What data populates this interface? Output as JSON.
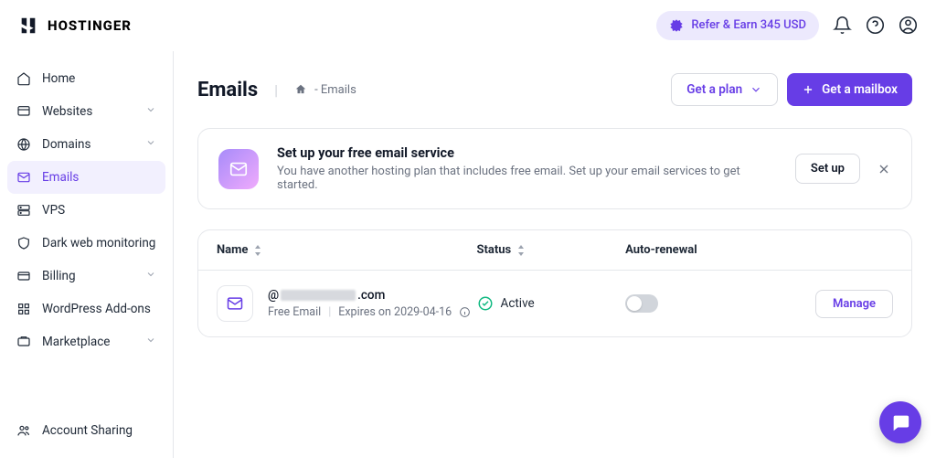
{
  "brand": "HOSTINGER",
  "header": {
    "refer_label": "Refer & Earn 345 USD"
  },
  "sidebar": {
    "items": [
      {
        "label": "Home",
        "icon": "home",
        "active": false,
        "expandable": false
      },
      {
        "label": "Websites",
        "icon": "websites",
        "active": false,
        "expandable": true
      },
      {
        "label": "Domains",
        "icon": "domains",
        "active": false,
        "expandable": true
      },
      {
        "label": "Emails",
        "icon": "emails",
        "active": true,
        "expandable": false
      },
      {
        "label": "VPS",
        "icon": "vps",
        "active": false,
        "expandable": false
      },
      {
        "label": "Dark web monitoring",
        "icon": "shield",
        "active": false,
        "expandable": false
      },
      {
        "label": "Billing",
        "icon": "billing",
        "active": false,
        "expandable": true
      },
      {
        "label": "WordPress Add-ons",
        "icon": "addons",
        "active": false,
        "expandable": false
      },
      {
        "label": "Marketplace",
        "icon": "marketplace",
        "active": false,
        "expandable": true
      }
    ],
    "bottom": {
      "label": "Account Sharing"
    }
  },
  "page": {
    "title": "Emails",
    "breadcrumb": "- Emails",
    "get_plan": "Get a plan",
    "get_mailbox": "Get a mailbox"
  },
  "setup": {
    "title": "Set up your free email service",
    "desc": "You have another hosting plan that includes free email. Set up your email services to get started.",
    "button": "Set up"
  },
  "table": {
    "headers": {
      "name": "Name",
      "status": "Status",
      "renewal": "Auto-renewal"
    },
    "rows": [
      {
        "domain_prefix": "@",
        "domain_suffix": ".com",
        "plan": "Free Email",
        "expires": "Expires on 2029-04-16",
        "status": "Active",
        "auto_renewal": false,
        "manage": "Manage"
      }
    ]
  }
}
